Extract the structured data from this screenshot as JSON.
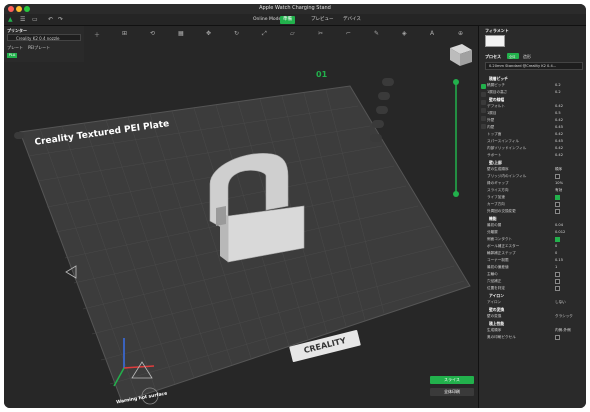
{
  "window": {
    "title": "Apple Watch Charging Stand"
  },
  "menubar": {
    "tabs": [
      {
        "label": "Online Models"
      },
      {
        "label": "準備"
      },
      {
        "label": "プレビュー"
      },
      {
        "label": "デバイス"
      }
    ]
  },
  "left_panel": {
    "printer_label": "プリンター",
    "printer_name": "Creality K2 0.4 nozzle",
    "plate_label": "プレート",
    "plate_value": "PEIプレート",
    "filament_tag": "PLA"
  },
  "viewport": {
    "plate_title": "Creality Textured PEI Plate",
    "plate_number": "01",
    "brand_logo": "CREALITY",
    "warning_text": "Warning hot surface"
  },
  "right_panel": {
    "filament_header": "フィラメント",
    "process_header": "プロセス",
    "process_toggle": "全体",
    "process_toggle_alt": "造形",
    "profile_name": "0.20mm Standard @Creality K2 0.4...",
    "sections": [
      {
        "title": "積層ピッチ"
      },
      {
        "title": "壁の線幅"
      },
      {
        "title": "壁/上部"
      },
      {
        "title": "機能"
      },
      {
        "title": "アイロン"
      },
      {
        "title": "壁の変換"
      },
      {
        "title": "積上性能"
      }
    ],
    "params": [
      {
        "label": "積層ピッチ",
        "value": "0.2"
      },
      {
        "label": "1層目の高さ",
        "value": "0.2"
      },
      {
        "label": "デフォルト",
        "value": "0.42"
      },
      {
        "label": "1層目",
        "value": "0.5"
      },
      {
        "label": "外壁",
        "value": "0.42"
      },
      {
        "label": "内壁",
        "value": "0.45"
      },
      {
        "label": "トップ面",
        "value": "0.42"
      },
      {
        "label": "スパースインフィル",
        "value": "0.45"
      },
      {
        "label": "内部ソリッドインフィル",
        "value": "0.42"
      },
      {
        "label": "サポート",
        "value": "0.42"
      },
      {
        "label": "壁の生成順序",
        "value": "順序"
      },
      {
        "label": "ブリッジ内のインフィル",
        "value": ""
      },
      {
        "label": "縁のギャップ",
        "value": "10%"
      },
      {
        "label": "スライス方向",
        "value": "有効"
      },
      {
        "label": "ライフ加速",
        "value": ""
      },
      {
        "label": "カーブ方向",
        "value": ""
      },
      {
        "label": "外周回の交換変更",
        "value": ""
      },
      {
        "label": "最初の層",
        "value": "0.04"
      },
      {
        "label": "分離層",
        "value": "0.012"
      },
      {
        "label": "側面コンタクト",
        "value": ""
      },
      {
        "label": "ボール補正エスター",
        "value": "0"
      },
      {
        "label": "輪郭補正ステップ",
        "value": "0"
      },
      {
        "label": "コーナー制限",
        "value": "0.15"
      },
      {
        "label": "最初の偏差値",
        "value": "1"
      },
      {
        "label": "主輪の",
        "value": ""
      },
      {
        "label": "穴径補正",
        "value": ""
      },
      {
        "label": "位置を判定",
        "value": ""
      },
      {
        "label": "アイロン",
        "value": "しない"
      },
      {
        "label": "壁の変換",
        "value": "クラシック"
      },
      {
        "label": "生成順序",
        "value": "内側-外側"
      },
      {
        "label": "奥の印刷ピクセル",
        "value": ""
      }
    ],
    "slice_button": "スライス",
    "print_button": "全体印刷"
  },
  "colors": {
    "accent": "#22b14c",
    "bed": "#3a3a3a",
    "background": "#272727",
    "panel": "#2a2a2a",
    "model": "#d8d8d8"
  }
}
